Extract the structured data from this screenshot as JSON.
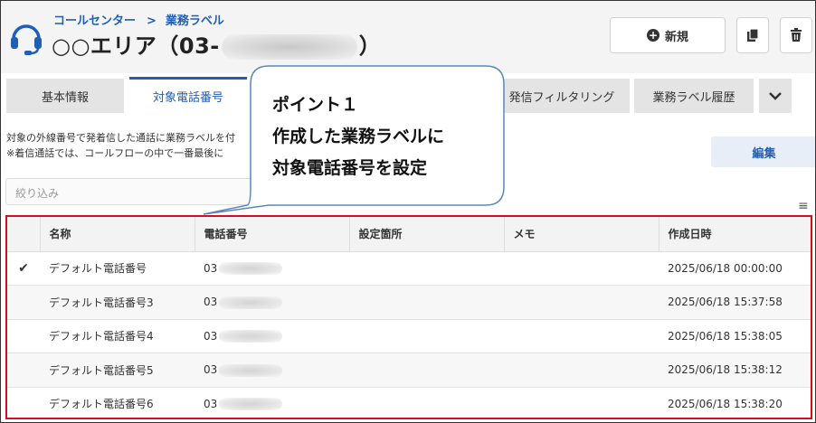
{
  "breadcrumb": {
    "root": "コールセンター",
    "separator": ">",
    "current": "業務ラベル"
  },
  "header": {
    "title_prefix": "○○エリア（03-",
    "title_suffix": "）"
  },
  "toolbar": {
    "new_label": "新規",
    "copy_icon": "copy-icon",
    "delete_icon": "trash-icon"
  },
  "tabs": [
    {
      "label": "基本情報"
    },
    {
      "label": "対象電話番号",
      "active": true
    },
    {
      "label": "発信フィルタリング"
    },
    {
      "label": "業務ラベル履歴"
    }
  ],
  "description": {
    "line1": "対象の外線番号で発着信した通話に業務ラベルを付",
    "line2": "※着信通話では、コールフローの中で一番最後に"
  },
  "edit_label": "編集",
  "filter": {
    "placeholder": "絞り込み"
  },
  "table": {
    "headers": [
      "",
      "名称",
      "電話番号",
      "設定箇所",
      "メモ",
      "作成日時"
    ],
    "rows": [
      {
        "checked": "✔",
        "name": "デフォルト電話番号",
        "phone": "03",
        "location": "",
        "memo": "",
        "created": "2025/06/18 00:00:00"
      },
      {
        "checked": "",
        "name": "デフォルト電話番号3",
        "phone": "03",
        "location": "",
        "memo": "",
        "created": "2025/06/18 15:37:58"
      },
      {
        "checked": "",
        "name": "デフォルト電話番号4",
        "phone": "03",
        "location": "",
        "memo": "",
        "created": "2025/06/18 15:38:05"
      },
      {
        "checked": "",
        "name": "デフォルト電話番号5",
        "phone": "03",
        "location": "",
        "memo": "",
        "created": "2025/06/18 15:38:12"
      },
      {
        "checked": "",
        "name": "デフォルト電話番号6",
        "phone": "03",
        "location": "",
        "memo": "",
        "created": "2025/06/18 15:38:20"
      }
    ]
  },
  "callout": {
    "line1": "ポイント１",
    "line2": "作成した業務ラベルに",
    "line3": "対象電話番号を設定"
  },
  "colors": {
    "accent": "#1f5fb8",
    "highlight_border": "#d0101b"
  }
}
